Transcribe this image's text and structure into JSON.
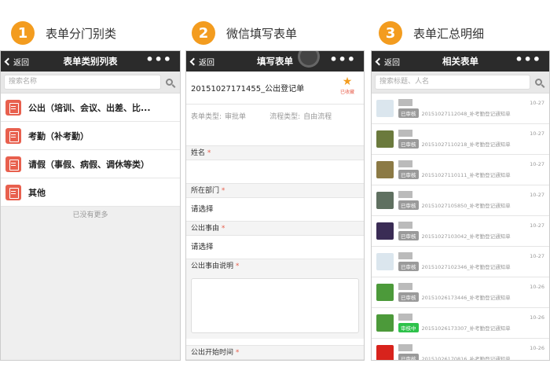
{
  "steps": [
    {
      "number": "1",
      "title": "表单分门别类"
    },
    {
      "number": "2",
      "title": "微信填写表单"
    },
    {
      "number": "3",
      "title": "表单汇总明细"
    }
  ],
  "colors": {
    "accent": "#f39c1f",
    "icon_red": "#e8604e",
    "navbar": "#2b2b2b",
    "badge_green": "#2ec24b"
  },
  "phone1": {
    "back_label": "返回",
    "title": "表单类别列表",
    "more": "•••",
    "search_placeholder": "搜索名称",
    "categories": [
      "公出（培训、会议、出差、比...",
      "考勤（补考勤）",
      "请假（事假、病假、调休等类）",
      "其他"
    ],
    "no_more": "已没有更多"
  },
  "phone2": {
    "back_label": "返回",
    "title": "填写表单",
    "more": "•••",
    "form_name": "20151027171455_公出登记单",
    "stamp_label": "已收藏",
    "form_type_label": "表单类型:",
    "form_type_value": "审批单",
    "flow_type_label": "流程类型:",
    "flow_type_value": "自由流程",
    "fields": {
      "name": "姓名",
      "dept": "所在部门",
      "dept_value": "请选择",
      "reason": "公出事由",
      "reason_value": "请选择",
      "reason_desc": "公出事由说明",
      "start_time": "公出开始时间"
    }
  },
  "phone3": {
    "back_label": "返回",
    "title": "相关表单",
    "more": "•••",
    "search_placeholder": "搜索标题、人名",
    "records": [
      {
        "badge": "已审核",
        "title": "20151027112048_补考勤登记通知单",
        "date": "10-27",
        "avatar": "#dbe6ee",
        "status": "approved"
      },
      {
        "badge": "已审核",
        "title": "20151027110218_补考勤登记通知单",
        "date": "10-27",
        "avatar": "#6b7a3d",
        "status": "approved"
      },
      {
        "badge": "已审核",
        "title": "20151027110111_补考勤登记通知单",
        "date": "10-27",
        "avatar": "#8c7a45",
        "status": "approved"
      },
      {
        "badge": "已审核",
        "title": "20151027105850_补考勤登记通知单",
        "date": "10-27",
        "avatar": "#5f7060",
        "status": "approved"
      },
      {
        "badge": "已审核",
        "title": "20151027103042_补考勤登记通知单",
        "date": "10-27",
        "avatar": "#3a2c55",
        "status": "approved"
      },
      {
        "badge": "已审核",
        "title": "20151027102346_补考勤登记通知单",
        "date": "10-27",
        "avatar": "#dbe6ee",
        "status": "approved"
      },
      {
        "badge": "已审核",
        "title": "20151026173446_补考勤登记通知单",
        "date": "10-26",
        "avatar": "#4c9a3a",
        "status": "approved"
      },
      {
        "badge": "审核中",
        "title": "20151026173307_补考勤登记通知单",
        "date": "10-26",
        "avatar": "#4c9a3a",
        "status": "pending"
      },
      {
        "badge": "已审核",
        "title": "20151026170816_补考勤登记通知单",
        "date": "10-26",
        "avatar": "#d8231c",
        "status": "approved"
      }
    ]
  }
}
